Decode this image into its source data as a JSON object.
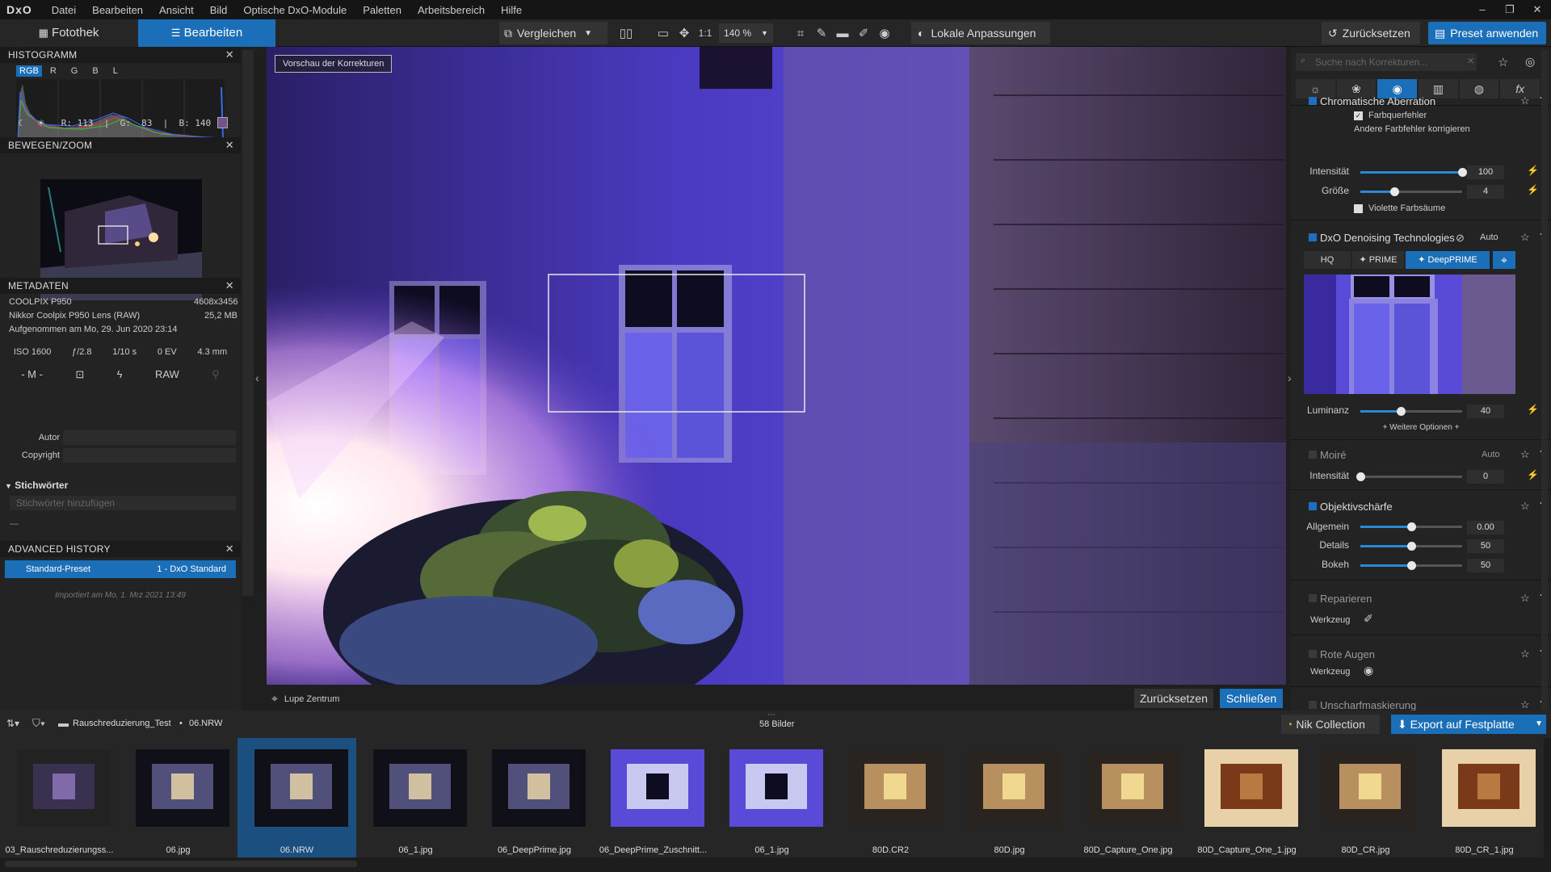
{
  "app": {
    "logo": "DxO"
  },
  "menu": [
    "Datei",
    "Bearbeiten",
    "Ansicht",
    "Bild",
    "Optische DxO-Module",
    "Paletten",
    "Arbeitsbereich",
    "Hilfe"
  ],
  "window_controls": [
    "–",
    "❐",
    "✕"
  ],
  "toolbar": {
    "tab_library": "Fotothek",
    "tab_edit": "Bearbeiten",
    "compare": "Vergleichen",
    "one_to_one": "1:1",
    "zoom": "140 %",
    "local_adjust": "Lokale Anpassungen",
    "reset": "Zurücksetzen",
    "apply_preset": "Preset anwenden"
  },
  "histogram": {
    "title": "HISTOGRAMM",
    "channels": [
      "RGB",
      "R",
      "G",
      "B",
      "L"
    ],
    "readout": "R: 113  |  G:  83  |  B: 140"
  },
  "movezoom": {
    "title": "BEWEGEN/ZOOM"
  },
  "metadata": {
    "title": "METADATEN",
    "camera": "COOLPIX P950",
    "dimensions": "4608x3456",
    "lens": "Nikkor Coolpix P950 Lens (RAW)",
    "size": "25,2 MB",
    "date": "Aufgenommen am Mo, 29. Jun 2020 23:14",
    "iso": "ISO 1600",
    "aperture": "ƒ/2.8",
    "shutter": "1/10 s",
    "ev": "0 EV",
    "focal": "4.3 mm",
    "mode": "- M -",
    "format": "RAW",
    "author_label": "Autor",
    "copyright_label": "Copyright"
  },
  "keywords": {
    "title": "Stichwörter",
    "placeholder": "Stichwörter hinzufügen",
    "dash": "—"
  },
  "history": {
    "title": "ADVANCED HISTORY",
    "entry_name": "Standard-Preset",
    "entry_value": "1 - DxO Standard",
    "imported": "Importiert am Mo, 1. Mrz 2021 13:49"
  },
  "viewer": {
    "preview_label": "Vorschau der Korrekturen",
    "loupe": "Lupe Zentrum",
    "reset": "Zurücksetzen",
    "close": "Schließen"
  },
  "right": {
    "search_placeholder": "Suche nach Korrekturen...",
    "ca": {
      "title": "Chromatische Aberration",
      "farbquerfehler": "Farbquerfehler",
      "other": "Andere Farbfehler korrigieren",
      "intensity_label": "Intensität",
      "intensity": "100",
      "intensity_fraction": 1.0,
      "size_label": "Größe",
      "size": "4",
      "size_fraction": 0.33,
      "violet": "Violette Farbsäume"
    },
    "denoise": {
      "title": "DxO Denoising Technologies",
      "auto": "Auto",
      "modes": [
        "HQ",
        "✦ PRIME",
        "✦ DeepPRIME"
      ],
      "luminance_label": "Luminanz",
      "luminance": "40",
      "luminance_fraction": 0.4,
      "more": "+ Weitere Optionen +"
    },
    "moire": {
      "title": "Moiré",
      "auto": "Auto",
      "intensity_label": "Intensität",
      "intensity": "0",
      "intensity_fraction": 0
    },
    "sharpness": {
      "title": "Objektivschärfe",
      "general_label": "Allgemein",
      "general": "0.00",
      "general_fraction": 0.5,
      "details_label": "Details",
      "details": "50",
      "details_fraction": 0.5,
      "bokeh_label": "Bokeh",
      "bokeh": "50",
      "bokeh_fraction": 0.5
    },
    "repair": {
      "title": "Reparieren",
      "tool_label": "Werkzeug"
    },
    "redeye": {
      "title": "Rote Augen",
      "tool_label": "Werkzeug"
    },
    "unsharp": {
      "title": "Unscharfmaskierung"
    }
  },
  "bottombar": {
    "folder": "Rauschreduzierung_Test",
    "file": "06.NRW",
    "count": "58 Bilder",
    "nik": "Nik Collection",
    "export": "Export auf Festplatte"
  },
  "filmstrip": [
    {
      "name": "03_Rauschreduzierungss...",
      "tone": "dark"
    },
    {
      "name": "06.jpg",
      "tone": "night"
    },
    {
      "name": "06.NRW",
      "tone": "night",
      "selected": true
    },
    {
      "name": "06_1.jpg",
      "tone": "night"
    },
    {
      "name": "06_DeepPrime.jpg",
      "tone": "night"
    },
    {
      "name": "06_DeepPrime_Zuschnitt...",
      "tone": "purple"
    },
    {
      "name": "06_1.jpg",
      "tone": "purple"
    },
    {
      "name": "80D.CR2",
      "tone": "house"
    },
    {
      "name": "80D.jpg",
      "tone": "house"
    },
    {
      "name": "80D_Capture_One.jpg",
      "tone": "house"
    },
    {
      "name": "80D_Capture_One_1.jpg",
      "tone": "door"
    },
    {
      "name": "80D_CR.jpg",
      "tone": "house"
    },
    {
      "name": "80D_CR_1.jpg",
      "tone": "door"
    }
  ],
  "colors": {
    "accent": "#1b6fb8",
    "panel": "#232323"
  }
}
